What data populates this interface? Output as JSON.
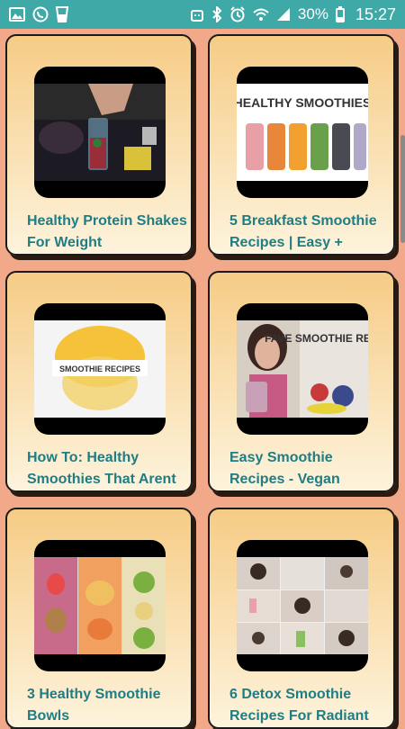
{
  "status_bar": {
    "battery_percent": "30%",
    "time": "15:27",
    "left_icons": [
      "gallery-icon",
      "whatsapp-icon",
      "glass-icon"
    ],
    "right_icons": [
      "android-icon",
      "bluetooth-icon",
      "alarm-icon",
      "wifi-icon",
      "signal-icon",
      "battery-icon"
    ]
  },
  "cards": [
    {
      "title": "Healthy Protein Shakes For Weight",
      "thumb": "protein-shake-thumbnail"
    },
    {
      "title": "5 Breakfast Smoothie Recipes | Easy +",
      "thumb": "healthy-smoothies-thumbnail",
      "overlay": "HEALTHY SMOOTHIES"
    },
    {
      "title": "How To: Healthy Smoothies That Arent",
      "thumb": "smoothie-recipes-thumbnail",
      "overlay": "SMOOTHIE RECIPES"
    },
    {
      "title": "Easy Smoothie Recipes - Vegan",
      "thumb": "fave-smoothie-thumbnail",
      "overlay": "FAVE SMOOTHIE RECIPES"
    },
    {
      "title": "3 Healthy Smoothie Bowls",
      "thumb": "smoothie-bowls-thumbnail"
    },
    {
      "title": "6 Detox Smoothie Recipes For Radiant",
      "thumb": "detox-smoothie-thumbnail"
    }
  ],
  "colors": {
    "background": "#f2a98a",
    "status_bar": "#3fa9a7",
    "title_text": "#1f7d84"
  }
}
